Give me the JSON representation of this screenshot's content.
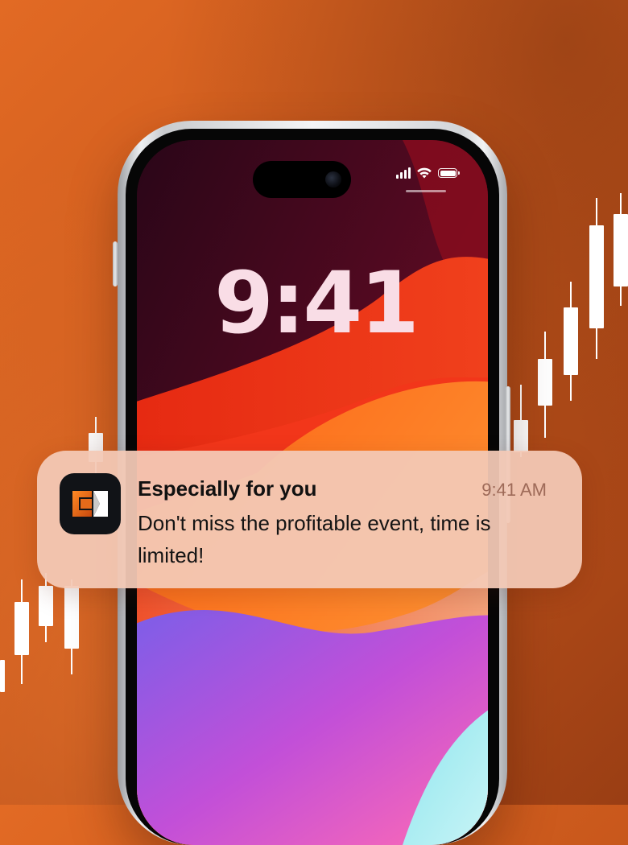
{
  "lock_screen": {
    "clock": "9:41"
  },
  "status_bar": {
    "icons": [
      "cellular-signal-icon",
      "wifi-icon",
      "battery-icon"
    ]
  },
  "notification": {
    "app_icon": "broker-app-logo-icon",
    "title": "Especially for you",
    "time": "9:41 AM",
    "body": "Don't miss the profitable event, time is limited!"
  },
  "colors": {
    "background": "#d1601f",
    "notification_bg": "#f3c9b6",
    "clock_text": "#f9dde6",
    "candle": "#ffffff"
  }
}
